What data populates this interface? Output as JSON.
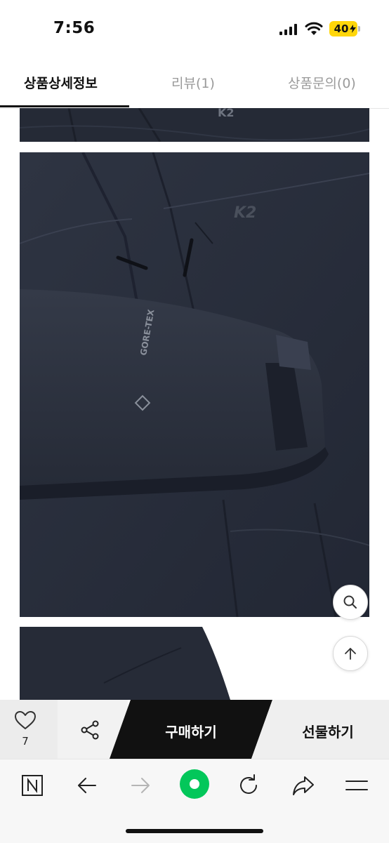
{
  "status_bar": {
    "time": "7:56",
    "battery": "40",
    "icons": [
      "cellular-signal-icon",
      "wifi-icon",
      "battery-charging-icon"
    ]
  },
  "tabs": [
    {
      "label": "상품상세정보",
      "active": true
    },
    {
      "label": "리뷰(1)",
      "active": false
    },
    {
      "label": "상품문의(0)",
      "active": false
    }
  ],
  "product_images": {
    "brand_logo": "K2",
    "fabric_tag": "GORE-TEX"
  },
  "floating_buttons": {
    "zoom_icon": "magnifier-icon",
    "scroll_top_icon": "arrow-up-icon"
  },
  "purchase_bar": {
    "like_count": "7",
    "buy_label": "구매하기",
    "gift_label": "선물하기",
    "colors": {
      "buy": "#111111",
      "gift": "#efefef"
    }
  },
  "browser_toolbar": {
    "icons": [
      "naver-home-icon",
      "back-arrow-icon",
      "forward-arrow-icon",
      "green-dot-icon",
      "reload-icon",
      "share-arrow-icon",
      "menu-icon"
    ],
    "accent": "#03c75a"
  }
}
